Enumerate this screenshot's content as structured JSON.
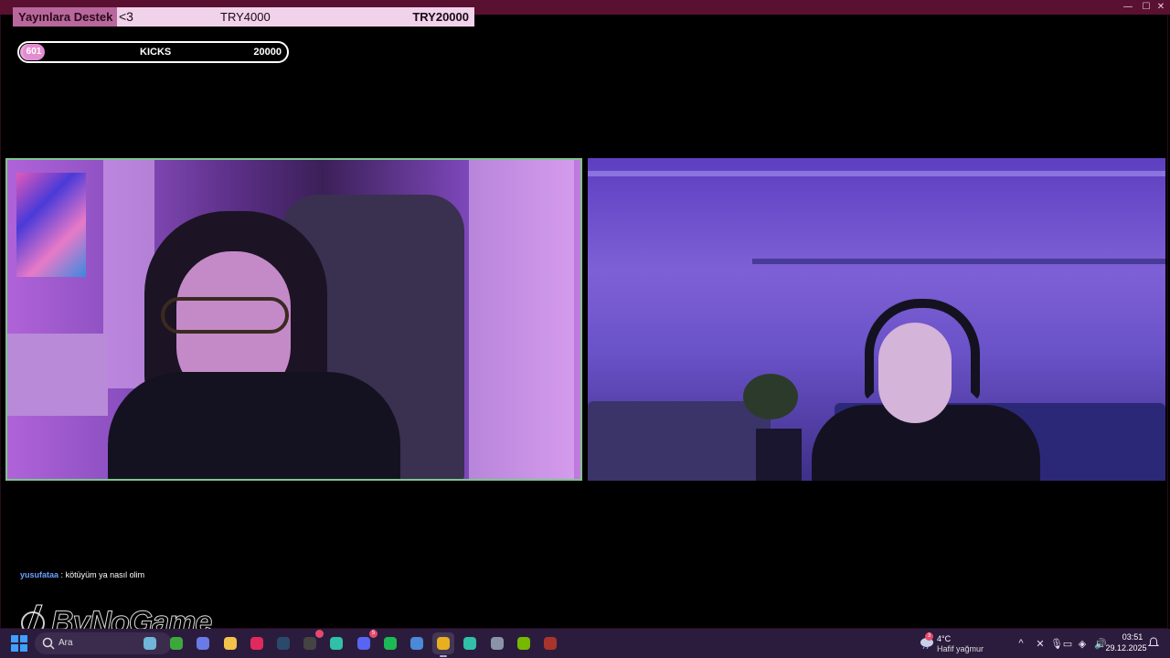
{
  "window": {
    "controls": {
      "minimize": "—",
      "maximize": "☐",
      "close": "✕"
    },
    "accent_color": "#5a1030"
  },
  "donation": {
    "title": "Yayınlara Destek",
    "heart": "<3",
    "current": "TRY4000",
    "target": "TRY20000",
    "progress": 0.2
  },
  "kicks": {
    "count": "601",
    "label": "KICKS",
    "target": "20000",
    "progress": 0.03
  },
  "chat": {
    "username": "yusufataa",
    "separator": ":",
    "message": "kötüyüm ya nasıl olim"
  },
  "watermark": {
    "text": "ByNoGame"
  },
  "taskbar": {
    "search_placeholder": "Ara",
    "apps": [
      {
        "name": "widget-app",
        "color": "#6fb6d8"
      },
      {
        "name": "xbox-app",
        "color": "#3ca83c"
      },
      {
        "name": "copilot-app",
        "color": "#6a7ae6"
      },
      {
        "name": "file-explorer-app",
        "color": "#f2c24a"
      },
      {
        "name": "opera-gx-app",
        "color": "#e02a5e"
      },
      {
        "name": "steam-app",
        "color": "#2a4a6c"
      },
      {
        "name": "obs-app",
        "color": "#444",
        "badge": ""
      },
      {
        "name": "terminal-app",
        "color": "#30c0a8"
      },
      {
        "name": "discord-app",
        "color": "#5865f2",
        "badge": "5"
      },
      {
        "name": "spotify-app",
        "color": "#1db954"
      },
      {
        "name": "network-app",
        "color": "#4a8ad8"
      },
      {
        "name": "chrome-app",
        "color": "#e8b020",
        "active": true
      },
      {
        "name": "kick-app",
        "color": "#30c0a8"
      },
      {
        "name": "settings-app",
        "color": "#8a94a8"
      },
      {
        "name": "nvidia-app",
        "color": "#76b900"
      },
      {
        "name": "winrar-app",
        "color": "#a8342c"
      }
    ],
    "weather": {
      "badge": "3",
      "temp": "4°C",
      "desc": "Hafif yağmur"
    },
    "tray": {
      "chevron": "^",
      "mute_icon": "✕",
      "mic_icon": "🎙",
      "display_icon": "▭",
      "network_icon": "◈",
      "volume_icon": "🔊"
    },
    "clock": {
      "time": "03:51",
      "date": "29.12.2025"
    }
  }
}
